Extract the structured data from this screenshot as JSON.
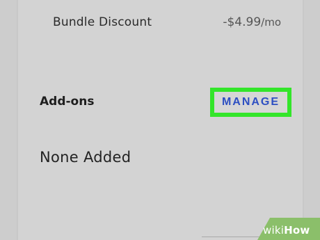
{
  "bundle": {
    "label": "Bundle Discount",
    "amount": "-$4.99",
    "unit": "/mo"
  },
  "addons": {
    "label": "Add-ons",
    "manage_label": "MANAGE",
    "empty_text": "None Added"
  },
  "watermark": {
    "prefix": "wiki",
    "suffix": "How"
  },
  "colors": {
    "background": "#cdcdcd",
    "highlight": "#33e52a",
    "link": "#2d4fc2",
    "watermark_green": "#8bbf6a"
  }
}
